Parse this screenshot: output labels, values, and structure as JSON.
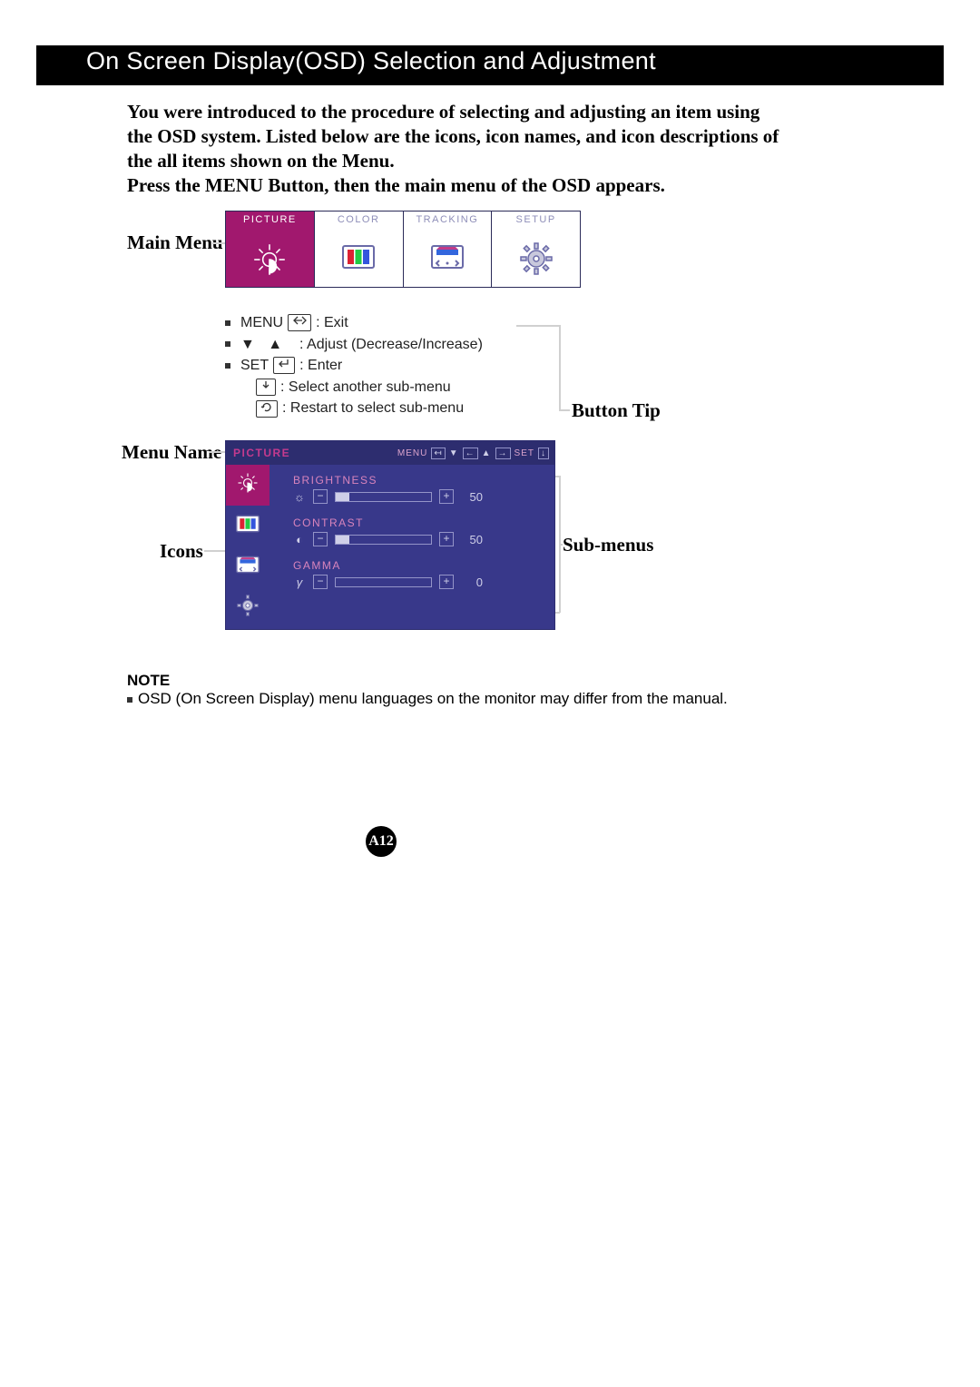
{
  "header": {
    "title": "On Screen Display(OSD) Selection and Adjustment"
  },
  "intro_text": "You were introduced to the procedure of selecting and adjusting an item using the OSD system.  Listed below are the icons, icon names, and icon descriptions of the all items shown on the Menu.",
  "instruction_text": "Press the MENU Button, then the main menu of the OSD appears.",
  "labels": {
    "main_menu": "Main Menu",
    "menu_name": "Menu Name",
    "icons": "Icons",
    "button_tip": "Button Tip",
    "sub_menus": "Sub-menus"
  },
  "main_menu": {
    "tabs": [
      {
        "label": "PICTURE",
        "selected": true
      },
      {
        "label": "COLOR",
        "selected": false
      },
      {
        "label": "TRACKING",
        "selected": false
      },
      {
        "label": "SETUP",
        "selected": false
      }
    ]
  },
  "button_tips": {
    "menu_label": "MENU",
    "menu_action": ": Exit",
    "adjust_action": ": Adjust (Decrease/Increase)",
    "set_label": "SET",
    "set_action": ": Enter",
    "select_sub": ": Select another sub-menu",
    "restart_sub": ": Restart to select sub-menu"
  },
  "osd_panel": {
    "title": "PICTURE",
    "legend": {
      "menu": "MENU",
      "set": "SET"
    },
    "icons": [
      "picture-icon",
      "color-icon",
      "tracking-icon",
      "setup-icon"
    ],
    "sub_items": [
      {
        "label": "BRIGHTNESS",
        "icon": "sun-icon",
        "value": 50,
        "fill_pct": 14
      },
      {
        "label": "CONTRAST",
        "icon": "contrast-icon",
        "value": 50,
        "fill_pct": 14
      },
      {
        "label": "GAMMA",
        "icon": "gamma-icon",
        "value": 0,
        "fill_pct": 0
      }
    ]
  },
  "note": {
    "title": "NOTE",
    "text": "OSD (On Screen Display) menu languages on the monitor may differ from the manual."
  },
  "page_number": "A12"
}
